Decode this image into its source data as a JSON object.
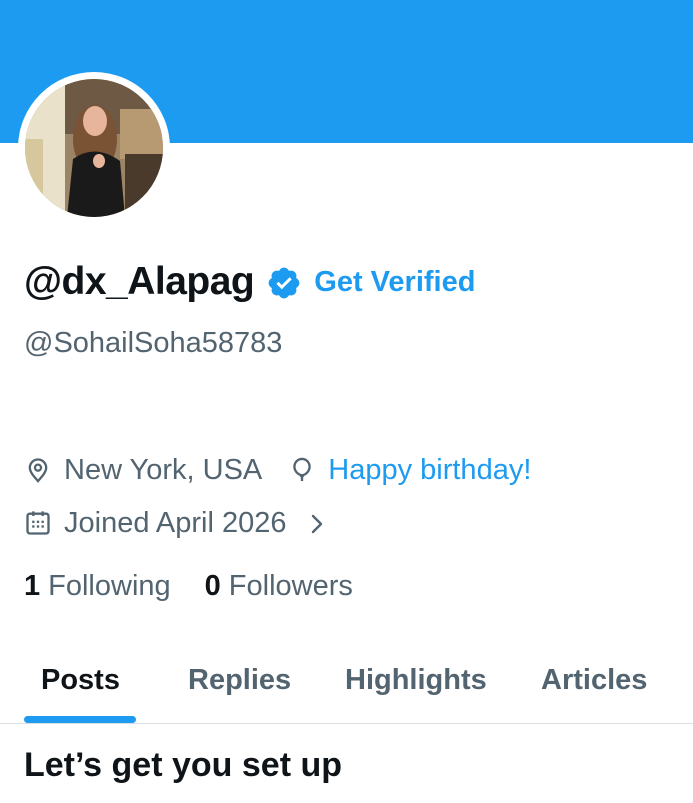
{
  "profile": {
    "display_name": "@dx_Alapag",
    "handle": "@SohailSoha58783",
    "get_verified_label": "Get Verified",
    "location": "New York, USA",
    "birthday_text": "Happy birthday!",
    "joined": "Joined April 2026",
    "following_count": "1",
    "following_label": "Following",
    "followers_count": "0",
    "followers_label": "Followers"
  },
  "tabs": [
    {
      "label": "Posts",
      "active": true
    },
    {
      "label": "Replies",
      "active": false
    },
    {
      "label": "Highlights",
      "active": false
    },
    {
      "label": "Articles",
      "active": false
    }
  ],
  "setup": {
    "title": "Let’s get you set up"
  },
  "icons": {
    "verified": "verified-badge-icon",
    "location": "location-pin-icon",
    "birthday": "balloon-icon",
    "calendar": "calendar-icon",
    "chevron": "chevron-right-icon"
  },
  "colors": {
    "banner": "#1d9bf0",
    "accent": "#1d9bf0",
    "text_primary": "#0f1419",
    "text_secondary": "#536471",
    "divider": "#d9dee2"
  }
}
